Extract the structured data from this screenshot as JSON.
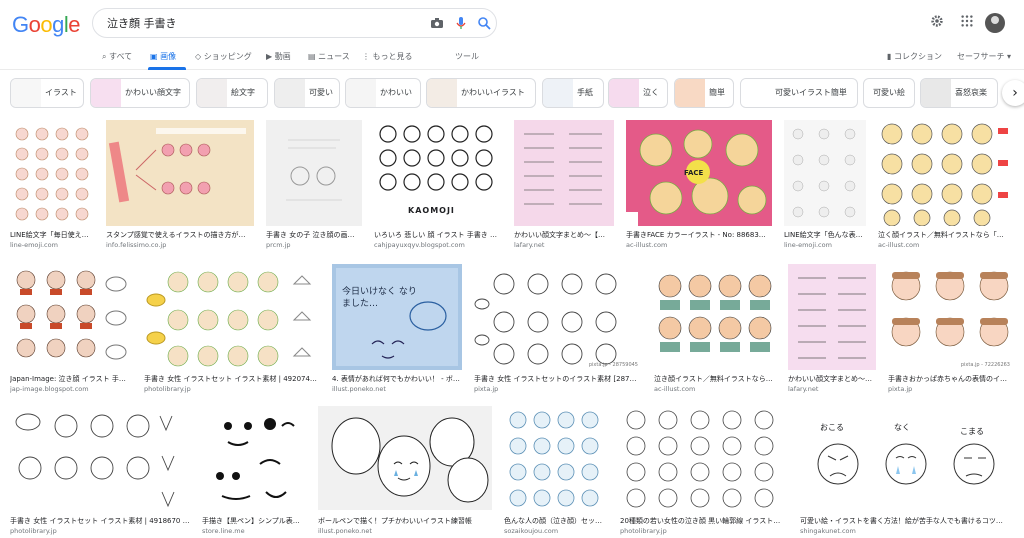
{
  "header": {
    "logo_text": "Google",
    "query": "泣き顔 手書き",
    "camera_icon": "camera-icon",
    "mic_icon": "mic-icon",
    "search_icon": "search-icon"
  },
  "tabs": [
    {
      "label": "すべて",
      "icon": "search-icon"
    },
    {
      "label": "画像",
      "icon": "image-icon"
    },
    {
      "label": "ショッピング",
      "icon": "tag-icon"
    },
    {
      "label": "動画",
      "icon": "play-icon"
    },
    {
      "label": "ニュース",
      "icon": "news-icon"
    },
    {
      "label": "もっと見る",
      "icon": "more-icon"
    },
    {
      "label": "ツール"
    }
  ],
  "tab_right": {
    "collections": "コレクション",
    "safesearch": "セーフサーチ ▾"
  },
  "chips": [
    "イラスト",
    "かわいい顔文字",
    "絵文字",
    "可愛い",
    "かわいい",
    "かわいいイラスト",
    "手紙",
    "泣く",
    "簡単",
    "可愛いイラスト簡単",
    "可愛い絵",
    "喜怒哀楽"
  ],
  "results": [
    {
      "title": "LINE絵文字「毎日使え…",
      "source": "line-emoji.com"
    },
    {
      "title": "スタンプ感覚で使えるイラストの描き方が…",
      "source": "info.felissimo.co.jp"
    },
    {
      "title": "手書き 女の子 泣き顔の画…",
      "source": "prcm.jp"
    },
    {
      "title": "いろいろ 悲しい 顔 イラスト 手書き …",
      "source": "cahjpayuxqyv.blogspot.com"
    },
    {
      "title": "かわいい顔文字まとめ～【…",
      "source": "lafary.net"
    },
    {
      "title": "手書きFACE カラーイラスト - No: 88683…",
      "source": "ac-illust.com"
    },
    {
      "title": "LINE絵文字「色んな表…",
      "source": "line-emoji.com"
    },
    {
      "title": "泣く顔イラスト／無料イラストなら「…",
      "source": "ac-illust.com"
    },
    {
      "title": "Japan-Image: 泣き顔 イラスト 手…",
      "source": "jap-image.blogspot.com"
    },
    {
      "title": "手書き 女性 イラストセット イラスト素材 | 492074…",
      "source": "photolibrary.jp"
    },
    {
      "title": "4. 表情があれば何でもかわいい！ - ボ…",
      "source": "illust.poneko.net"
    },
    {
      "title": "手書き 女性 イラストセットのイラスト素材 [287…",
      "source": "pixta.jp"
    },
    {
      "title": "泣き顔イラスト／無料イラストなら「…",
      "source": "ac-illust.com"
    },
    {
      "title": "かわいい顔文字まとめ～【…",
      "source": "lafary.net"
    },
    {
      "title": "手書きおかっぱ赤ちゃんの表情のイ…",
      "source": "pixta.jp"
    },
    {
      "title": "手書き 女性 イラストセット イラスト素材 | 4918670 …",
      "source": "photolibrary.jp"
    },
    {
      "title": "手描き【黒ペン】シンプル表…",
      "source": "store.line.me"
    },
    {
      "title": "ボールペンで描く！プチかわいいイラスト練習帳",
      "source": "illust.poneko.net"
    },
    {
      "title": "色んな人の顔（泣き顔）セッ…",
      "source": "sozaikoujou.com"
    },
    {
      "title": "20種類の若い女性の泣き顔 黒い輪郭線 イラスト…",
      "source": "photolibrary.jp"
    },
    {
      "title": "可愛い絵・イラストを書く方法！絵が苦手な人でも書けるコツ…",
      "source": "shingakunet.com"
    }
  ],
  "image_texts": {
    "kaomoji": "KAOMOJI",
    "sticky": "今日いけなく なりました…",
    "face": "FACE",
    "pixta1": "pixta.jp - 28759045",
    "pixta2": "pixta.jp - 72226263",
    "okoru": "おこる",
    "naku": "なく",
    "komaru": "こまる"
  }
}
